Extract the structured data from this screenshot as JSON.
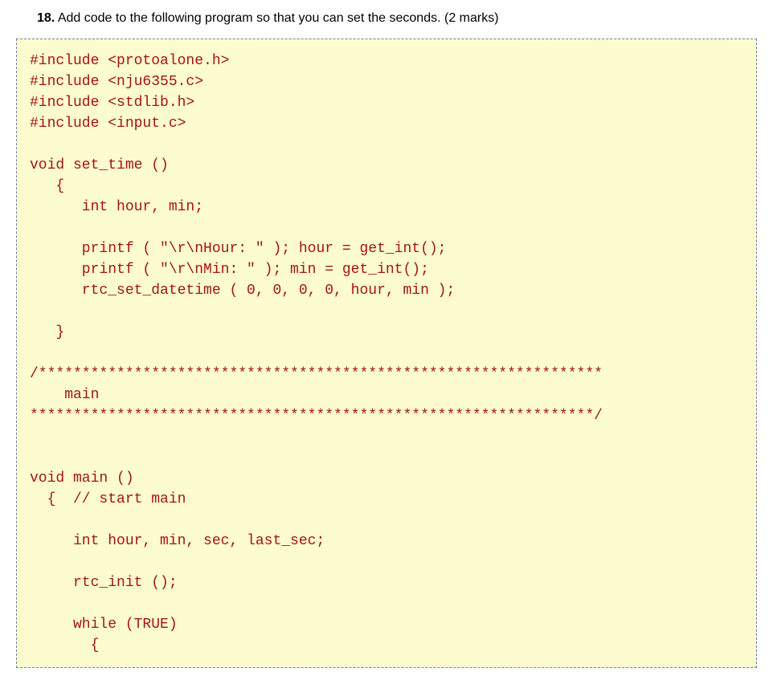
{
  "question": {
    "number": "18.",
    "text": "Add code to the following program so that you can set the seconds. (2 marks)"
  },
  "code": "#include <protoalone.h>\n#include <nju6355.c>\n#include <stdlib.h>\n#include <input.c>\n\nvoid set_time ()\n   {\n      int hour, min;\n\n      printf ( \"\\r\\nHour: \" ); hour = get_int();\n      printf ( \"\\r\\nMin: \" ); min = get_int();\n      rtc_set_datetime ( 0, 0, 0, 0, hour, min );\n\n   }\n\n/*****************************************************************\n    main\n*****************************************************************/\n\n\nvoid main ()\n  {  // start main\n\n     int hour, min, sec, last_sec;\n\n     rtc_init ();\n\n     while (TRUE)\n       {"
}
